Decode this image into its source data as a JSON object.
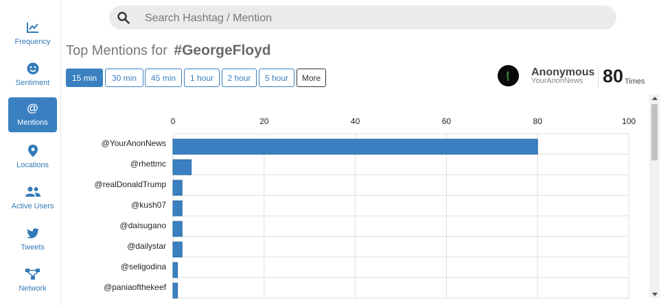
{
  "search": {
    "placeholder": "Search Hashtag / Mention"
  },
  "sidebar": {
    "items": [
      {
        "label": "Frequency",
        "icon": "line-chart-icon"
      },
      {
        "label": "Sentiment",
        "icon": "smiley-icon"
      },
      {
        "label": "Mentions",
        "icon": "at-sign-icon",
        "active": true
      },
      {
        "label": "Locations",
        "icon": "map-pin-icon"
      },
      {
        "label": "Active Users",
        "icon": "users-icon"
      },
      {
        "label": "Tweets",
        "icon": "twitter-bird-icon"
      },
      {
        "label": "Network",
        "icon": "network-icon"
      }
    ]
  },
  "header": {
    "title_prefix": "Top Mentions for",
    "hashtag": "#GeorgeFloyd"
  },
  "time_buttons": [
    "15 min",
    "30 min",
    "45 min",
    "1 hour",
    "2 hour",
    "5 hour",
    "More"
  ],
  "selected_time": "15 min",
  "top_user": {
    "name": "Anonymous",
    "handle": "YourAnonNews",
    "count": "80",
    "count_label": "Times"
  },
  "colors": {
    "accent": "#3a80c0",
    "bar": "#3a80c0"
  },
  "chart_data": {
    "type": "bar",
    "orientation": "horizontal",
    "categories": [
      "@YourAnonNews",
      "@rhettmc",
      "@realDonaldTrump",
      "@kush07",
      "@daisugano",
      "@dailystar",
      "@seligodina",
      "@paniaofthekeef"
    ],
    "values": [
      80,
      4,
      2,
      2,
      2,
      2,
      1,
      1
    ],
    "xlim": [
      0,
      100
    ],
    "xticks": [
      0,
      20,
      40,
      60,
      80,
      100
    ],
    "axis_position": "top",
    "grid": true
  }
}
